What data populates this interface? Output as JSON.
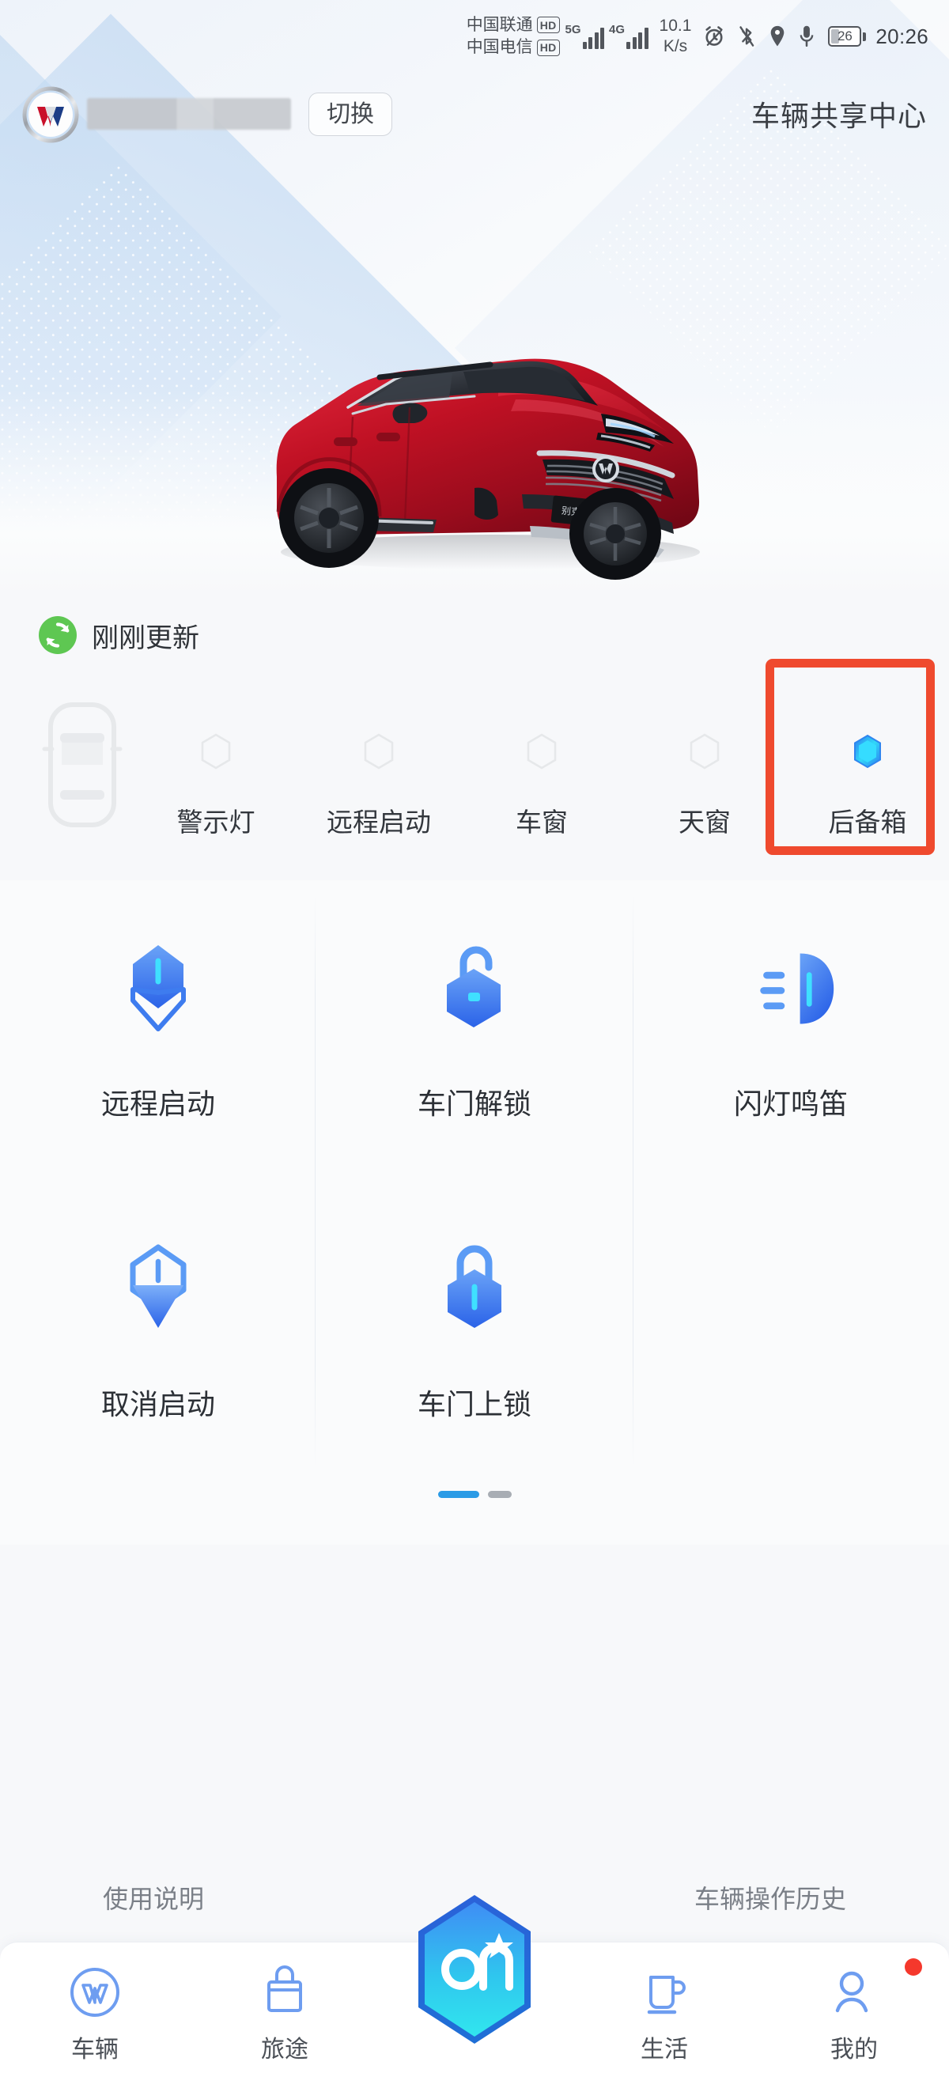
{
  "statusbar": {
    "carrier1": "中国联通",
    "carrier1_hd": "HD",
    "carrier1_net": "5G",
    "carrier2": "中国电信",
    "carrier2_hd": "HD",
    "carrier2_net": "4G",
    "net_speed_value": "10.1",
    "net_speed_unit": "K/s",
    "battery_percent": "26",
    "time": "20:26",
    "icons": [
      "alarm-icon",
      "bluetooth-off-icon",
      "location-icon",
      "microphone-icon",
      "battery-icon"
    ]
  },
  "header": {
    "logo": "buick-logo",
    "account_masked": "",
    "switch_label": "切换",
    "title": "车辆共享中心"
  },
  "vehicle": {
    "image": "red-suv-three-quarter-front",
    "plate_text": "别克昂科威S"
  },
  "update": {
    "icon": "refresh-icon",
    "text": "刚刚更新",
    "icon_color": "#5ec752"
  },
  "status_strip": {
    "car_outline_icon": "car-top-view-icon",
    "items": [
      {
        "label": "警示灯",
        "icon": "hexagon-icon",
        "active": false
      },
      {
        "label": "远程启动",
        "icon": "hexagon-icon",
        "active": false
      },
      {
        "label": "车窗",
        "icon": "hexagon-icon",
        "active": false
      },
      {
        "label": "天窗",
        "icon": "hexagon-icon",
        "active": false
      },
      {
        "label": "后备箱",
        "icon": "hexagon-icon",
        "active": true
      }
    ],
    "highlight_target": "后备箱",
    "highlight_color": "#ef4a2e"
  },
  "controls": {
    "cells": [
      {
        "label": "远程启动",
        "icon": "remote-start-icon"
      },
      {
        "label": "车门解锁",
        "icon": "unlock-icon"
      },
      {
        "label": "闪灯鸣笛",
        "icon": "flash-horn-icon"
      },
      {
        "label": "取消启动",
        "icon": "cancel-start-icon"
      },
      {
        "label": "车门上锁",
        "icon": "lock-icon"
      },
      {
        "label": "",
        "icon": ""
      }
    ],
    "pager": {
      "total": 2,
      "current": 1
    }
  },
  "footer": {
    "left_link": "使用说明",
    "right_link": "车辆操作历史"
  },
  "tabbar": {
    "items": [
      {
        "label": "车辆",
        "icon": "vehicle-icon",
        "badge": false
      },
      {
        "label": "旅途",
        "icon": "journey-bag-icon",
        "badge": false
      },
      {
        "label": "",
        "icon": "onstar-logo-icon",
        "badge": false
      },
      {
        "label": "生活",
        "icon": "life-cup-icon",
        "badge": false
      },
      {
        "label": "我的",
        "icon": "profile-icon",
        "badge": true
      }
    ],
    "center_label": "On"
  },
  "colors": {
    "accent_blue": "#3a7ef0",
    "cyan": "#2fd2f5",
    "highlight_red": "#ef4a2e",
    "green": "#5ec752",
    "pager_active": "#2b9be6"
  }
}
